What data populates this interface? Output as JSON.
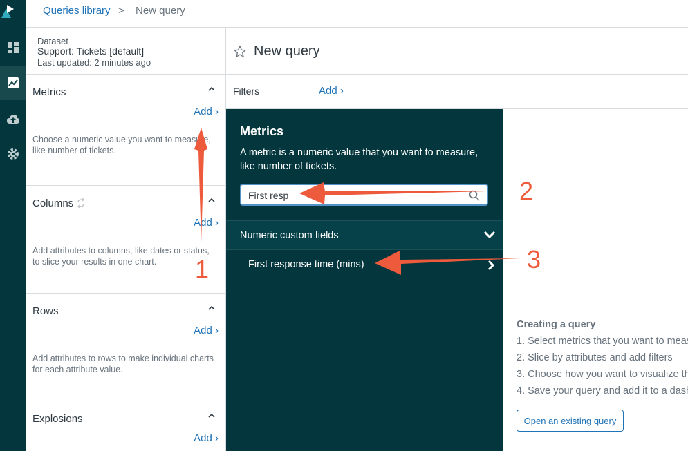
{
  "breadcrumb": {
    "link": "Queries library",
    "separator": ">",
    "current": "New query"
  },
  "nav": {
    "icons": [
      "logo-icon",
      "dashboard-icon",
      "queries-icon",
      "upload-icon",
      "settings-icon"
    ]
  },
  "dataset": {
    "label": "Dataset",
    "name": "Support: Tickets [default]",
    "updated": "Last updated: 2 minutes ago"
  },
  "sections": [
    {
      "title": "Metrics",
      "add": "Add ›",
      "desc": "Choose a numeric value you want to measure, like number of tickets."
    },
    {
      "title": "Columns",
      "add": "Add ›",
      "desc": "Add attributes to columns, like dates or status, to slice your results in one chart."
    },
    {
      "title": "Rows",
      "add": "Add ›",
      "desc": "Add attributes to rows to make individual charts for each attribute value."
    },
    {
      "title": "Explosions",
      "add": "Add ›",
      "desc": ""
    }
  ],
  "query": {
    "title": "New query"
  },
  "filters": {
    "label": "Filters",
    "add": "Add ›"
  },
  "panel": {
    "title": "Metrics",
    "desc": "A metric is a numeric value that you want to measure, like number of tickets.",
    "search_value": "First resp",
    "group_label": "Numeric custom fields",
    "option_label": "First response time (mins)"
  },
  "help": {
    "title": "Creating a query",
    "steps": [
      "1. Select metrics that you want to meas",
      "2. Slice by attributes and add filters",
      "3. Choose how you want to visualize th",
      "4. Save your query and add it to a dash"
    ],
    "button": "Open an existing query"
  },
  "annotations": {
    "labels": [
      "1",
      "2",
      "3"
    ],
    "color": "#ee5a3c"
  }
}
